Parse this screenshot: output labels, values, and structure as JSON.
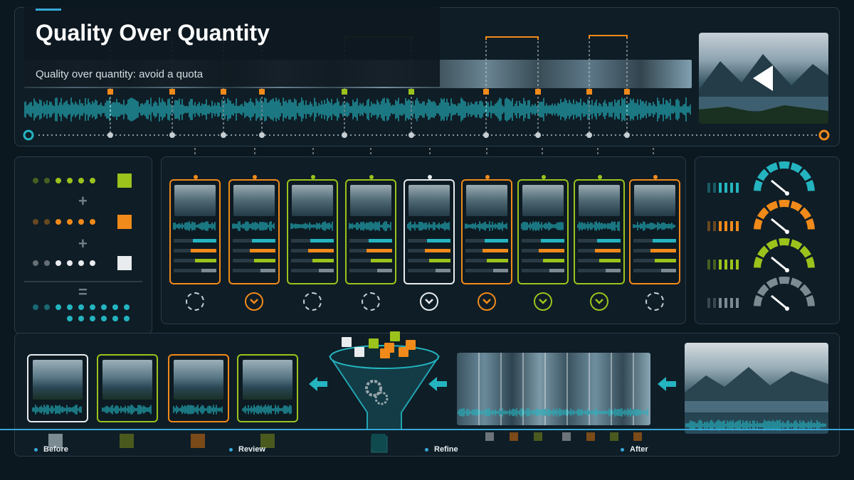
{
  "header": {
    "title": "Quality Over Quantity",
    "subtitle": "Quality over quantity: avoid a quota"
  },
  "colors": {
    "teal": "#24b4c0",
    "orange": "#f08a1a",
    "lime": "#9cc21c",
    "white": "#e8ecee",
    "grey": "#7c8a92",
    "accent_blue": "#36a8d8"
  },
  "icons": {
    "preview_play": "play-icon",
    "gear": "gear-icon",
    "arrow": "arrow-left-icon",
    "check": "check-icon"
  },
  "cards": [
    {
      "color": "orange",
      "checked": false
    },
    {
      "color": "orange",
      "checked": true
    },
    {
      "color": "lime",
      "checked": false
    },
    {
      "color": "lime",
      "checked": false
    },
    {
      "color": "white",
      "checked": true
    },
    {
      "color": "orange",
      "checked": true
    },
    {
      "color": "lime",
      "checked": true
    },
    {
      "color": "lime",
      "checked": true
    },
    {
      "color": "orange",
      "checked": false
    }
  ],
  "selection_rows": [
    {
      "color": "lime"
    },
    {
      "color": "orange"
    },
    {
      "color": "white"
    },
    {
      "color": "teal"
    }
  ],
  "gauges": [
    {
      "color": "teal"
    },
    {
      "color": "orange"
    },
    {
      "color": "lime"
    },
    {
      "color": "grey"
    }
  ],
  "outputs": [
    {
      "color": "white"
    },
    {
      "color": "lime"
    },
    {
      "color": "orange"
    },
    {
      "color": "lime"
    }
  ],
  "stages": [
    "Before",
    "Review",
    "Refine",
    "After"
  ]
}
